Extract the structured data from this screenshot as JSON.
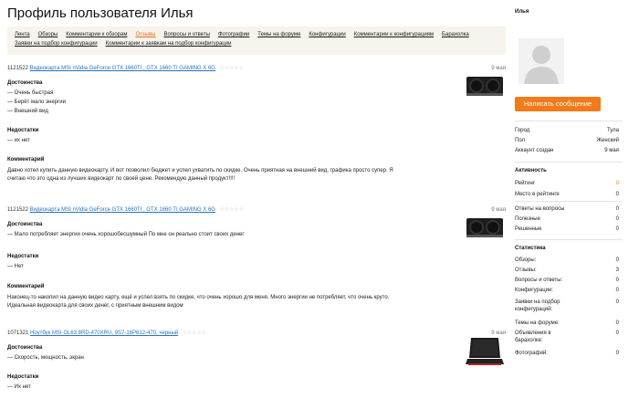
{
  "page": {
    "title": "Профиль пользователя Илья"
  },
  "tabs": {
    "row1": [
      "Лента",
      "Обзоры",
      "Комментарии к обзорам",
      "Отзывы",
      "Вопросы и ответы",
      "Фотографии",
      "Темы на форуме",
      "Конфигурации",
      "Комментарии к конфигурациям",
      "Барахолка"
    ],
    "row2": [
      "Заявки на подбор конфигурации",
      "Комментарии к заявкам на подбор конфигурации"
    ],
    "active": "Отзывы"
  },
  "reviews": [
    {
      "id": "1121522",
      "product": "Видеокарта MSI nVidia GeForce GTX 1660TI , GTX 1660 TI GAMING X 6G",
      "stars": "☆☆☆☆☆",
      "date": "9 мая",
      "pros_label": "Достоинства",
      "pros": [
        "—  Очень быстрая",
        "—  Берёт мало энергии",
        "—  Внешний вид"
      ],
      "cons_label": "Недостатки",
      "cons": [
        "—  их нет"
      ],
      "comment_label": "Комментарий",
      "comment": [
        "Давно хотел купить данную видеокарту. И вот позволил бюджет и успел ухватить по скидке. Очень приятная на внешний вид, графика просто супер. Я",
        "считаю что это одна из лучших видеокарт по своей цене. Рекомендую данный продукт!!!!"
      ]
    },
    {
      "id": "1121522",
      "product": "Видеокарта MSI nVidia GeForce GTX 1660TI , GTX 1660 TI GAMING X 6G",
      "stars": "☆☆☆☆☆",
      "date": "9 мая",
      "pros_label": "Достоинства",
      "pros": [
        "—  Мало потребляет энергии очень хорошобесшумный По мне он реально стоит своих денег"
      ],
      "cons_label": "Недостатки",
      "cons": [
        "—  Нет"
      ],
      "comment_label": "Комментарий",
      "comment": [
        "Наконец-то накопил на данную видео карту, ещё и успел взять по скидке, что очень хорошо для меня. Много энергии не потребляет, что очень круто.",
        "Идеальная видеокарта для своих денег, с приятным внешним видом"
      ]
    },
    {
      "id": "1071321",
      "product": "Ноутбук MSI GL63 8RD-470XRU, 9S7-16P612-470, черный",
      "stars": "☆☆☆☆☆",
      "date": "9 мая",
      "pros_label": "Достоинства",
      "pros": [
        "—  Скорость, мощность, экран"
      ],
      "cons_label": "Недостатки",
      "cons": [
        "—  Их нет"
      ]
    }
  ],
  "sidebar": {
    "name": "Илья",
    "message_button": "Написать сообщение",
    "info": [
      {
        "label": "Город",
        "value": "Тула"
      },
      {
        "label": "Пол",
        "value": "Женский"
      },
      {
        "label": "Аккаунт создан",
        "value": "9 мая"
      }
    ],
    "activity_title": "Активность",
    "activity": [
      {
        "label": "Рейтинг",
        "value": "0"
      },
      {
        "label": "Место в рейтинге",
        "value": "0"
      },
      {
        "label": "Ответы на вопросы",
        "value": "0"
      },
      {
        "label": "Полезные",
        "value": "0"
      },
      {
        "label": "Решенные",
        "value": "0"
      }
    ],
    "stats_title": "Статистика",
    "stats": [
      {
        "label": "Обзоры:",
        "value": "0"
      },
      {
        "label": "Отзывы:",
        "value": "3"
      },
      {
        "label": "Вопросы и ответы:",
        "value": "0"
      },
      {
        "label": "Конфигурации:",
        "value": "0"
      },
      {
        "label": "Заявки на подбор конфигураций:",
        "value": "0"
      },
      {
        "label": "Темы на форуме:",
        "value": "0"
      },
      {
        "label": "Объявления в барахолке:",
        "value": "0"
      },
      {
        "label": "Фотографий:",
        "value": "0"
      }
    ]
  }
}
